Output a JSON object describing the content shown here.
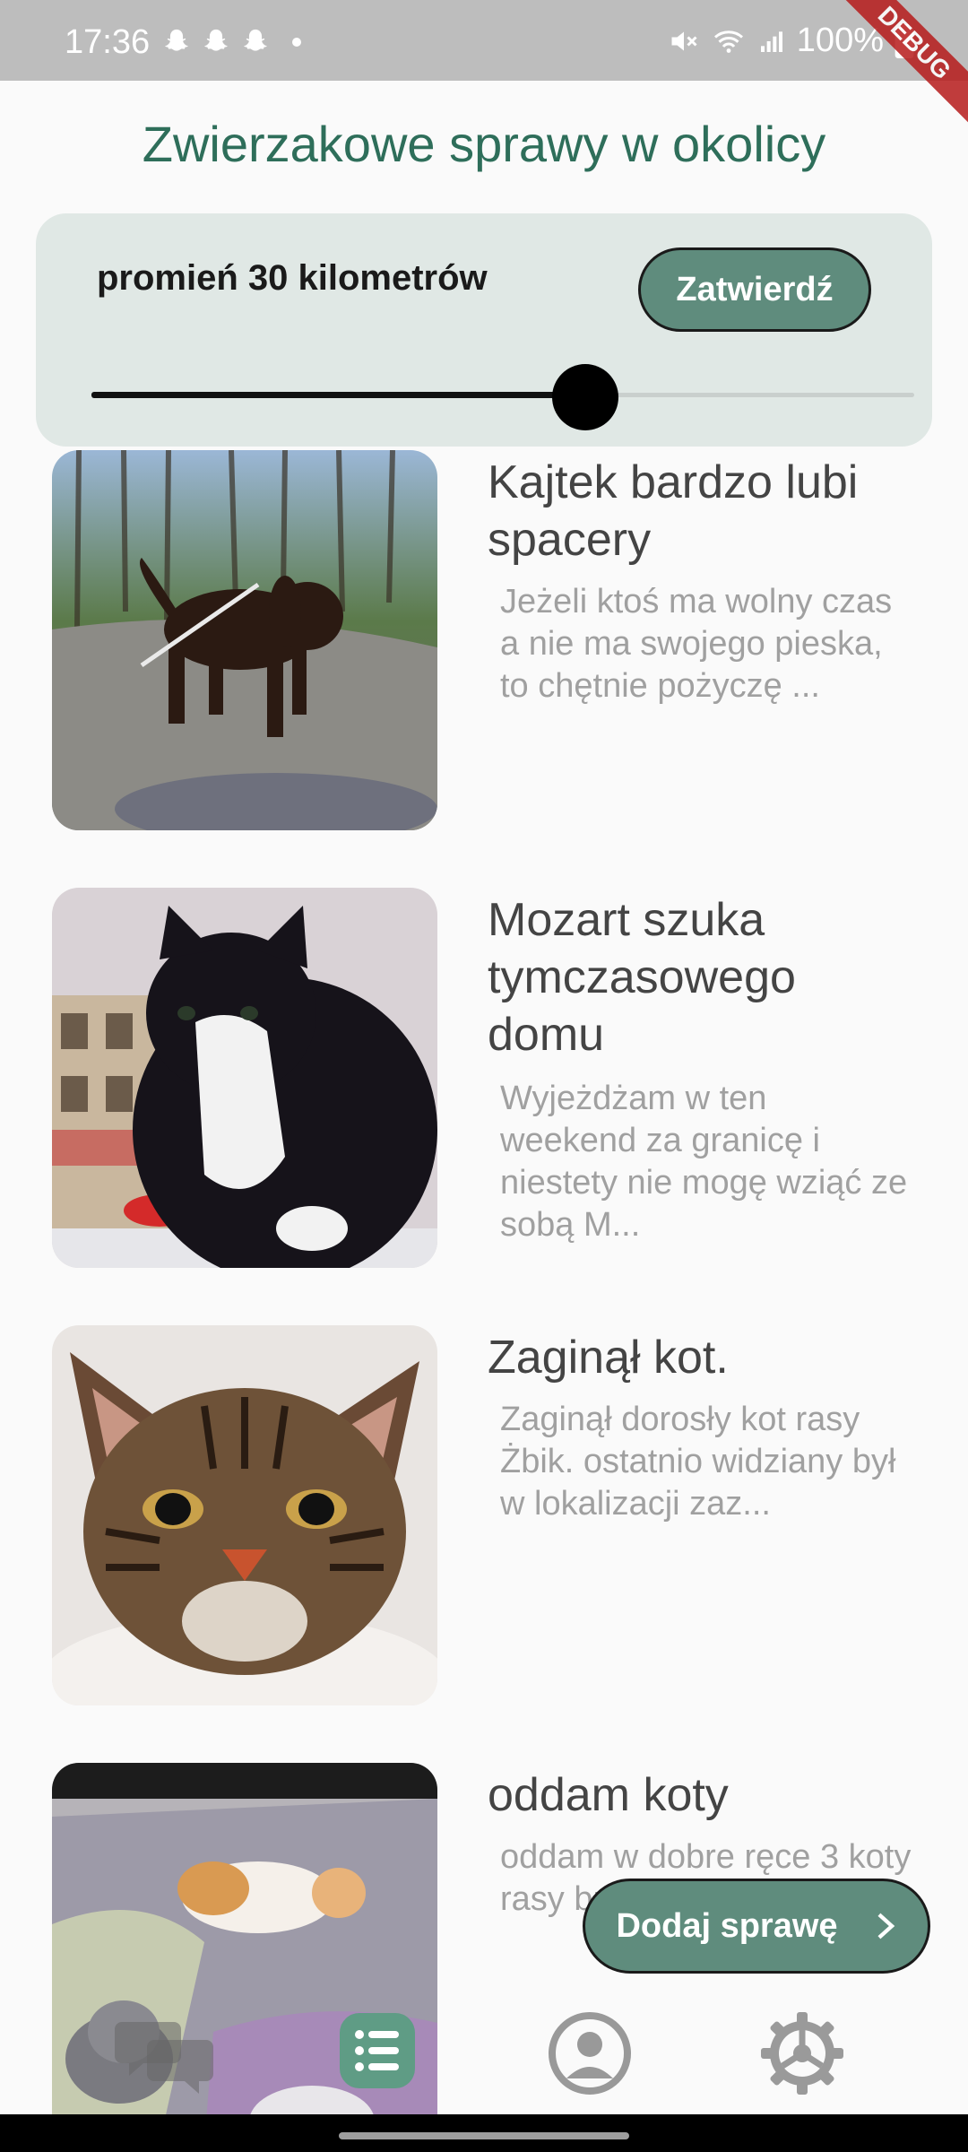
{
  "status_bar": {
    "time": "17:36",
    "battery": "100%",
    "icons": [
      "snapchat-icon",
      "snapchat-icon",
      "snapchat-icon",
      "dot",
      "mute-icon",
      "wifi-icon",
      "signal-icon",
      "battery-icon"
    ],
    "debug": "DEBUG"
  },
  "header": {
    "title": "Zwierzakowe sprawy w okolicy"
  },
  "filter": {
    "radius_label": "promień 30 kilometrów",
    "confirm_label": "Zatwierdź",
    "slider_value_fraction": 0.6
  },
  "cases": [
    {
      "title": "Kajtek bardzo lubi spacery",
      "description": "Jeżeli ktoś ma wolny czas a nie ma swojego pieska, to chętnie pożyczę ..."
    },
    {
      "title": "Mozart szuka tymczasowego domu",
      "description": "Wyjeżdżam w ten weekend za granicę i niestety nie mogę wziąć ze sobą M..."
    },
    {
      "title": "Zaginął kot.",
      "description": "Zaginął dorosły kot rasy Żbik. ostatnio widziany był w lokalizacji zaz..."
    },
    {
      "title": "oddam koty",
      "description": "oddam w dobre ręce 3 koty rasy brytyjskiej."
    }
  ],
  "fab": {
    "label": "Dodaj sprawę"
  },
  "bottom_nav": {
    "items": [
      "chat-icon",
      "list-icon",
      "profile-icon",
      "settings-icon"
    ],
    "active": "list-icon"
  },
  "colors": {
    "accent": "#5f8c7d",
    "title": "#2e6e5a",
    "card": "#e0e8e5"
  }
}
